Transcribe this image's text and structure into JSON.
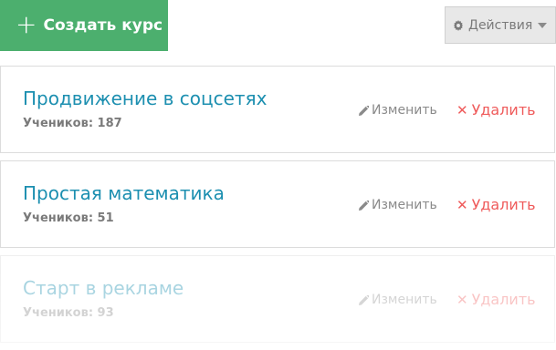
{
  "toolbar": {
    "create_label": "Создать курс",
    "actions_label": "Действия"
  },
  "courses": [
    {
      "title": "Продвижение в соцсетях",
      "students": "Учеников: 187",
      "edit_label": "Изменить",
      "delete_label": "Удалить"
    },
    {
      "title": "Простая математика",
      "students": "Учеников: 51",
      "edit_label": "Изменить",
      "delete_label": "Удалить"
    },
    {
      "title": "Старт в рекламе",
      "students": "Учеников: 93",
      "edit_label": "Изменить",
      "delete_label": "Удалить"
    }
  ],
  "icons": {
    "create": "plus-icon",
    "actions": "gear-icon",
    "dropdown": "chevron-down-icon",
    "edit": "pencil-icon",
    "delete": "close-icon"
  },
  "colors": {
    "primary": "#4caf6e",
    "link": "#1c8fb0",
    "danger": "#ef5b5b"
  }
}
